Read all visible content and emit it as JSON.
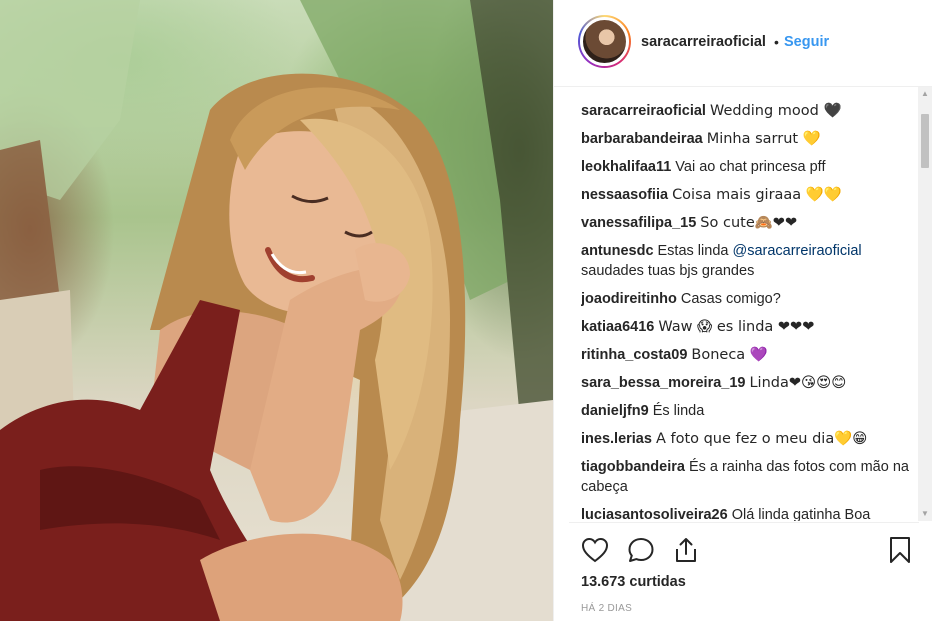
{
  "post": {
    "username": "saracarreiraoficial",
    "separator": "•",
    "follow_label": "Seguir",
    "likes": "13.673 curtidas",
    "timestamp": "HÁ 2 DIAS"
  },
  "comments": [
    {
      "user": "saracarreiraoficial",
      "text": "Wedding mood 🖤"
    },
    {
      "user": "barbarabandeiraa",
      "text": "Minha sarrut 💛"
    },
    {
      "user": "leokhalifaa11",
      "text": "Vai ao chat princesa pff"
    },
    {
      "user": "nessaasofiia",
      "text": "Coisa mais giraaa 💛💛"
    },
    {
      "user": "vanessafilipa_15",
      "text": "So cute🙈❤❤"
    },
    {
      "user": "antunesdc",
      "text_before": "Estas linda ",
      "mention": "@saracarreiraoficial",
      "text_after": " saudades tuas bjs grandes"
    },
    {
      "user": "joaodireitinho",
      "text": "Casas comigo?"
    },
    {
      "user": "katiaa6416",
      "text": "Waw 😱 es linda ❤❤❤"
    },
    {
      "user": "ritinha_costa09",
      "text": "Boneca 💜"
    },
    {
      "user": "sara_bessa_moreira_19",
      "text": "Linda❤😘😍😊"
    },
    {
      "user": "danieljfn9",
      "text": "És linda"
    },
    {
      "user": "ines.lerias",
      "text": "A foto que fez o meu dia💛😁"
    },
    {
      "user": "tiagobbandeira",
      "text": "És a rainha das fotos com mão na cabeça"
    },
    {
      "user": "luciasantosoliveira26",
      "text": "Olá linda gatinha Boa"
    }
  ],
  "icons": {
    "like": "heart-icon",
    "comment": "comment-bubble-icon",
    "share": "share-icon",
    "save": "bookmark-icon"
  },
  "colors": {
    "link_blue": "#3897f0",
    "mention_blue": "#003569",
    "dress": "#7a1f1c"
  }
}
